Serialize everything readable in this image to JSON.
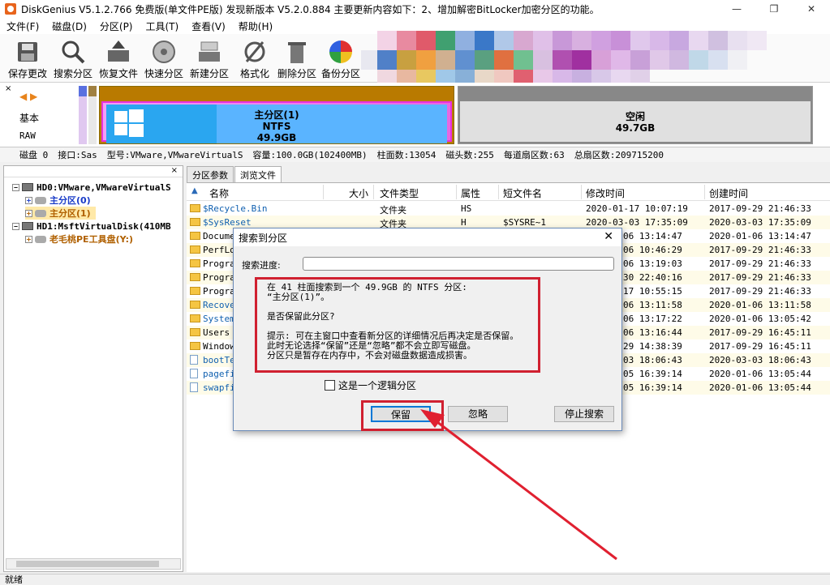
{
  "window": {
    "title": "DiskGenius V5.1.2.766 免费版(单文件PE版)   发现新版本 V5.2.0.884 主要更新内容如下：2、增加解密BitLocker加密分区的功能。",
    "minimize": "—",
    "maximize": "❐",
    "close": "✕"
  },
  "menu": [
    "文件(F)",
    "磁盘(D)",
    "分区(P)",
    "工具(T)",
    "查看(V)",
    "帮助(H)"
  ],
  "toolbar": [
    {
      "label": "保存更改",
      "icon": "save-icon"
    },
    {
      "label": "搜索分区",
      "icon": "search-icon"
    },
    {
      "label": "恢复文件",
      "icon": "recover-icon"
    },
    {
      "label": "快速分区",
      "icon": "quick-partition-icon"
    },
    {
      "label": "新建分区",
      "icon": "new-partition-icon"
    },
    {
      "label": "格式化",
      "icon": "format-icon"
    },
    {
      "label": "删除分区",
      "icon": "delete-icon"
    },
    {
      "label": "备份分区",
      "icon": "backup-icon"
    }
  ],
  "disk_panel": {
    "close": "×",
    "arrows": "◀ ▶",
    "type": "基本",
    "format": "RAW",
    "primary": {
      "name": "主分区(1)",
      "fs": "NTFS",
      "size": "49.9GB"
    },
    "free": {
      "name": "空闲",
      "size": "49.7GB"
    }
  },
  "disk_info": [
    "磁盘 0",
    "接口:Sas",
    "型号:VMware,VMwareVirtualS",
    "容量:100.0GB(102400MB)",
    "柱面数:13054",
    "磁头数:255",
    "每道扇区数:63",
    "总扇区数:209715200"
  ],
  "tree": {
    "close": "×",
    "items": [
      {
        "label": "HD0:VMware,VMwareVirtualS",
        "expander": "−"
      },
      {
        "label": "主分区(0)",
        "expander": "+"
      },
      {
        "label": "主分区(1)",
        "expander": "+"
      },
      {
        "label": "HD1:MsftVirtualDisk(410MB",
        "expander": "−"
      },
      {
        "label": "老毛桃PE工具盘(Y:)",
        "expander": "+"
      }
    ]
  },
  "tabs": [
    "分区参数",
    "浏览文件"
  ],
  "file_list": {
    "columns": [
      "名称",
      "大小",
      "文件类型",
      "属性",
      "短文件名",
      "修改时间",
      "创建时间"
    ],
    "rows": [
      {
        "name": "$Recycle.Bin",
        "type": "文件夹",
        "attr": "HS",
        "short": "",
        "modified": "2020-01-17 10:07:19",
        "created": "2017-09-29 21:46:33",
        "kind": "folder"
      },
      {
        "name": "$SysReset",
        "type": "文件夹",
        "attr": "H",
        "short": "$SYSRE~1",
        "modified": "2020-03-03 17:35:09",
        "created": "2020-03-03 17:35:09",
        "kind": "folder"
      },
      {
        "name": "Docume",
        "type": "",
        "attr": "",
        "short": "",
        "modified": "06 13:14:47",
        "created": "2020-01-06 13:14:47",
        "kind": "folder"
      },
      {
        "name": "PerfLo",
        "type": "",
        "attr": "",
        "short": "",
        "modified": "06 10:46:29",
        "created": "2017-09-29 21:46:33",
        "kind": "folder"
      },
      {
        "name": "Progra",
        "type": "",
        "attr": "",
        "short": "",
        "modified": "06 13:19:03",
        "created": "2017-09-29 21:46:33",
        "kind": "folder"
      },
      {
        "name": "Progra",
        "type": "",
        "attr": "",
        "short": "",
        "modified": "30 22:40:16",
        "created": "2017-09-29 21:46:33",
        "kind": "folder"
      },
      {
        "name": "Progra",
        "type": "",
        "attr": "",
        "short": "",
        "modified": "17 10:55:15",
        "created": "2017-09-29 21:46:33",
        "kind": "folder"
      },
      {
        "name": "Recove",
        "type": "",
        "attr": "",
        "short": "",
        "modified": "06 13:11:58",
        "created": "2020-01-06 13:11:58",
        "kind": "folder"
      },
      {
        "name": "System",
        "type": "",
        "attr": "",
        "short": "",
        "modified": "06 13:17:22",
        "created": "2020-01-06 13:05:42",
        "kind": "folder"
      },
      {
        "name": "Users",
        "type": "",
        "attr": "",
        "short": "",
        "modified": "06 13:16:44",
        "created": "2017-09-29 16:45:11",
        "kind": "folder"
      },
      {
        "name": "Window",
        "type": "",
        "attr": "",
        "short": "",
        "modified": "29 14:38:39",
        "created": "2017-09-29 16:45:11",
        "kind": "folder"
      },
      {
        "name": "bootTe",
        "type": "",
        "attr": "",
        "short": "",
        "modified": "03 18:06:43",
        "created": "2020-03-03 18:06:43",
        "kind": "file"
      },
      {
        "name": "pagefi",
        "type": "",
        "attr": "",
        "short": "",
        "modified": "05 16:39:14",
        "created": "2020-01-06 13:05:44",
        "kind": "file"
      },
      {
        "name": "swapfi",
        "type": "",
        "attr": "",
        "short": "",
        "modified": "05 16:39:14",
        "created": "2020-01-06 13:05:44",
        "kind": "file"
      }
    ]
  },
  "status": "就绪",
  "dialog": {
    "title": "搜索到分区",
    "close": "✕",
    "progress_label": "搜索进度:",
    "message": {
      "line1": "在 41 柱面搜索到一个 49.9GB 的 NTFS 分区:",
      "line2": "“主分区(1)”。",
      "question": "是否保留此分区?",
      "tip1": "提示: 可在主窗口中查看新分区的详细情况后再决定是否保留。",
      "tip2": "此时无论选择“保留”还是“忽略”都不会立即写磁盘。",
      "tip3": "分区只是暂存在内存中，不会对磁盘数据造成损害。"
    },
    "checkbox_label": "这是一个逻辑分区",
    "buttons": {
      "keep": "保留",
      "ignore": "忽略",
      "stop": "停止搜索"
    }
  },
  "colors": {
    "annotation": "#d02030",
    "selected_row": "#ffe9a8"
  }
}
